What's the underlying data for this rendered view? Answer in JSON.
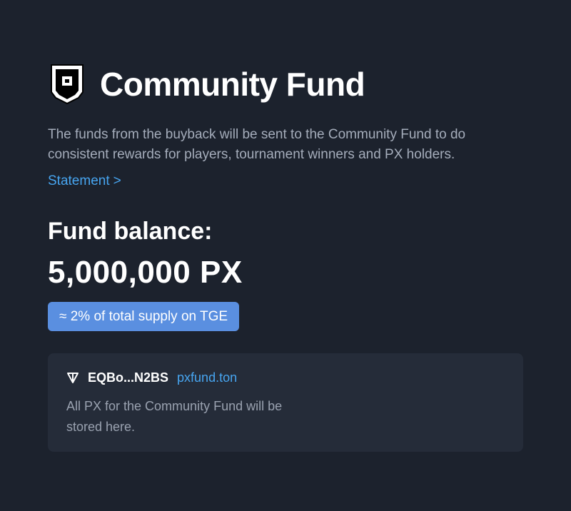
{
  "header": {
    "logo_icon": "shield-logo-icon",
    "title": "Community Fund"
  },
  "description": "The funds from the buyback will be sent to the Community Fund to do consistent rewards for players, tournament winners and PX holders.",
  "statement_link": {
    "label": "Statement",
    "chevron": ">"
  },
  "fund": {
    "balance_label": "Fund balance:",
    "balance_value": "5,000,000 PX",
    "supply_badge": "≈ 2% of total supply on TGE"
  },
  "wallet": {
    "icon": "ton-icon",
    "address": "EQBo...N2BS",
    "domain": "pxfund.ton",
    "note": "All PX for the Community Fund will be stored here."
  },
  "colors": {
    "background": "#1c222d",
    "card": "#252c39",
    "accent_link": "#47a5f0",
    "badge": "#5a8fe0",
    "muted_text": "#a5adbb"
  }
}
